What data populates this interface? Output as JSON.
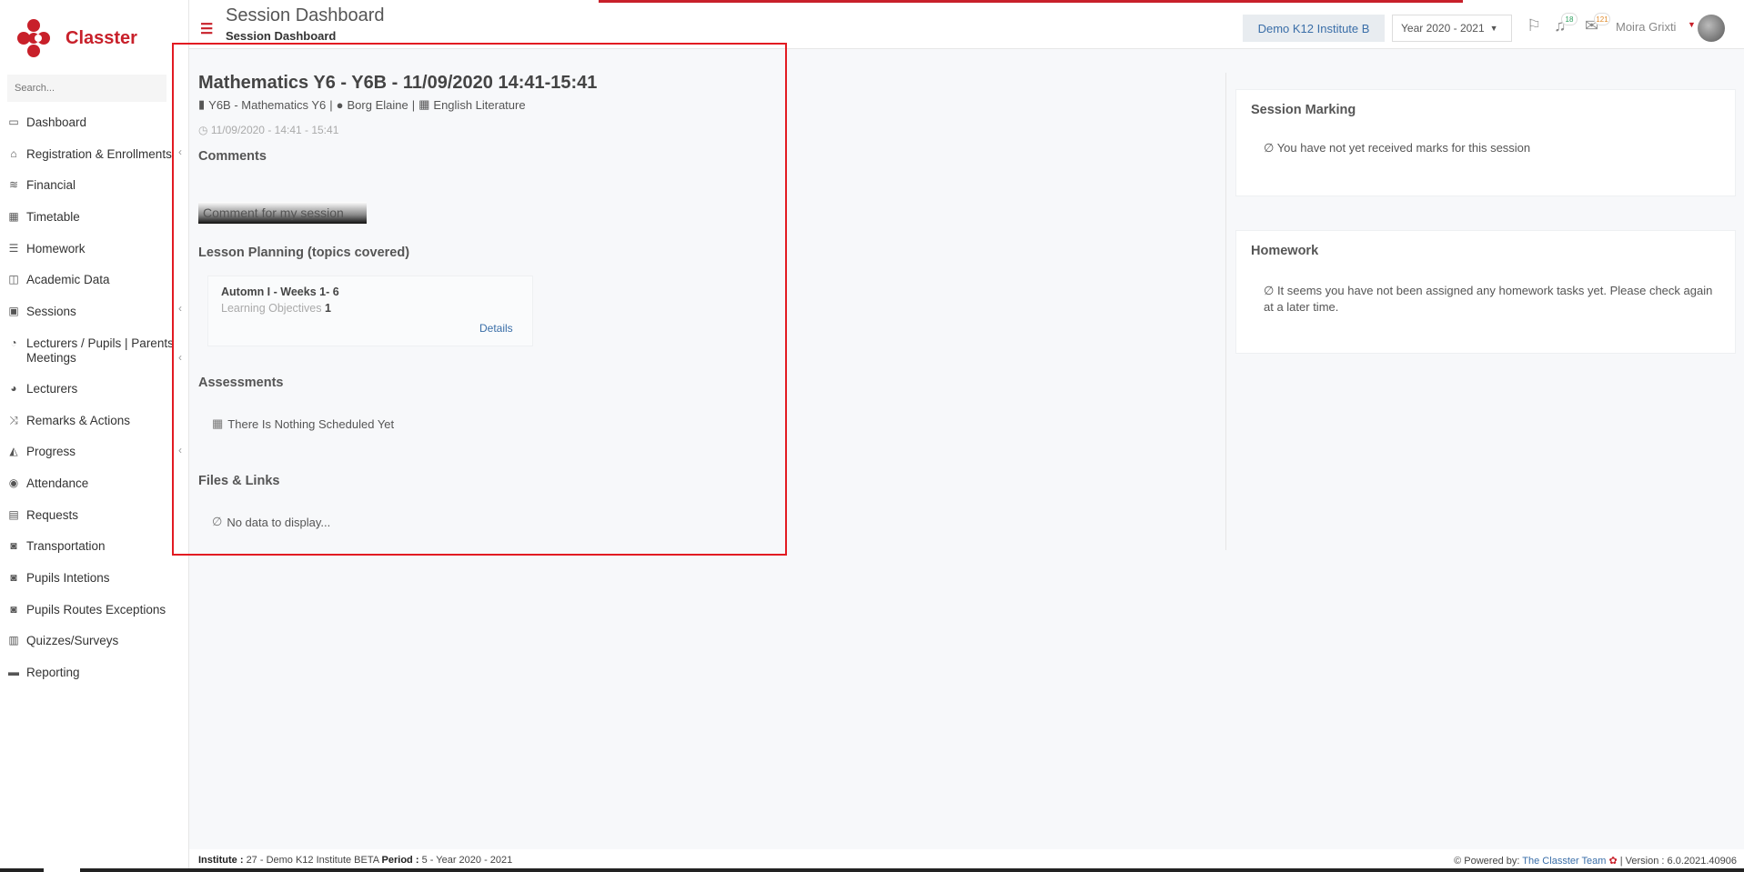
{
  "app": {
    "name": "Classter"
  },
  "sidebar": {
    "search_placeholder": "Search...",
    "items": [
      {
        "label": "Dashboard",
        "icon": "monitor-icon"
      },
      {
        "label": "Registration & Enrollments",
        "icon": "bank-icon"
      },
      {
        "label": "Financial",
        "icon": "coins-icon"
      },
      {
        "label": "Timetable",
        "icon": "calendar-icon"
      },
      {
        "label": "Homework",
        "icon": "list-icon"
      },
      {
        "label": "Academic Data",
        "icon": "chart-icon"
      },
      {
        "label": "Sessions",
        "icon": "presentation-icon"
      },
      {
        "label": "Lecturers / Pupils | Parents Meetings",
        "icon": "user-clock-icon"
      },
      {
        "label": "Lecturers",
        "icon": "users-icon"
      },
      {
        "label": "Remarks & Actions",
        "icon": "shuffle-icon"
      },
      {
        "label": "Progress",
        "icon": "graduation-cap-icon"
      },
      {
        "label": "Attendance",
        "icon": "user-x-icon"
      },
      {
        "label": "Requests",
        "icon": "document-icon"
      },
      {
        "label": "Transportation",
        "icon": "bus-icon"
      },
      {
        "label": "Pupils Intetions",
        "icon": "bus-icon"
      },
      {
        "label": "Pupils Routes Exceptions",
        "icon": "bus-icon"
      },
      {
        "label": "Quizzes/Surveys",
        "icon": "checklist-icon"
      },
      {
        "label": "Reporting",
        "icon": "printer-icon"
      }
    ]
  },
  "header": {
    "title": "Session Dashboard",
    "subtitle": "Session Dashboard",
    "institute_button": "Demo K12 Institute B",
    "year_select": "Year 2020 - 2021",
    "notifications_count": "18",
    "messages_count": "121",
    "user_name": "Moira Grixti"
  },
  "session": {
    "title": "Mathematics Y6 - Y6B - 11/09/2020 14:41-15:41",
    "class": "Y6B - Mathematics Y6",
    "sep1": "|",
    "lecturer": "Borg Elaine",
    "sep2": "|",
    "subject": "English Literature",
    "time": "11/09/2020 - 14:41 - 15:41",
    "comments_heading": "Comments",
    "comment_button": "Comment for my session",
    "lesson_heading": "Lesson Planning (topics covered)",
    "lesson_card": {
      "title": "Automn I - Weeks 1- 6",
      "objectives_label": "Learning Objectives",
      "objectives_count": "1",
      "details_link": "Details"
    },
    "assessments_heading": "Assessments",
    "assessments_empty": "There Is Nothing Scheduled Yet",
    "files_heading": "Files & Links",
    "files_empty": "No data to display..."
  },
  "right_panel": {
    "marking_title": "Session Marking",
    "marking_text": "You have not yet received marks for this session",
    "homework_title": "Homework",
    "homework_text": "It seems you have not been assigned any homework tasks yet. Please check again at a later time."
  },
  "footer": {
    "institute_label": "Institute :",
    "institute_value": "27 - Demo K12 Institute BETA",
    "period_label": "Period :",
    "period_value": "5 - Year 2020 - 2021",
    "powered_by": "Powered by:",
    "team_link": "The Classter Team",
    "version": "| Version : 6.0.2021.40906"
  },
  "colors": {
    "brand": "#c8202a",
    "link": "#3a6ea8",
    "highlight": "#e21b22"
  }
}
